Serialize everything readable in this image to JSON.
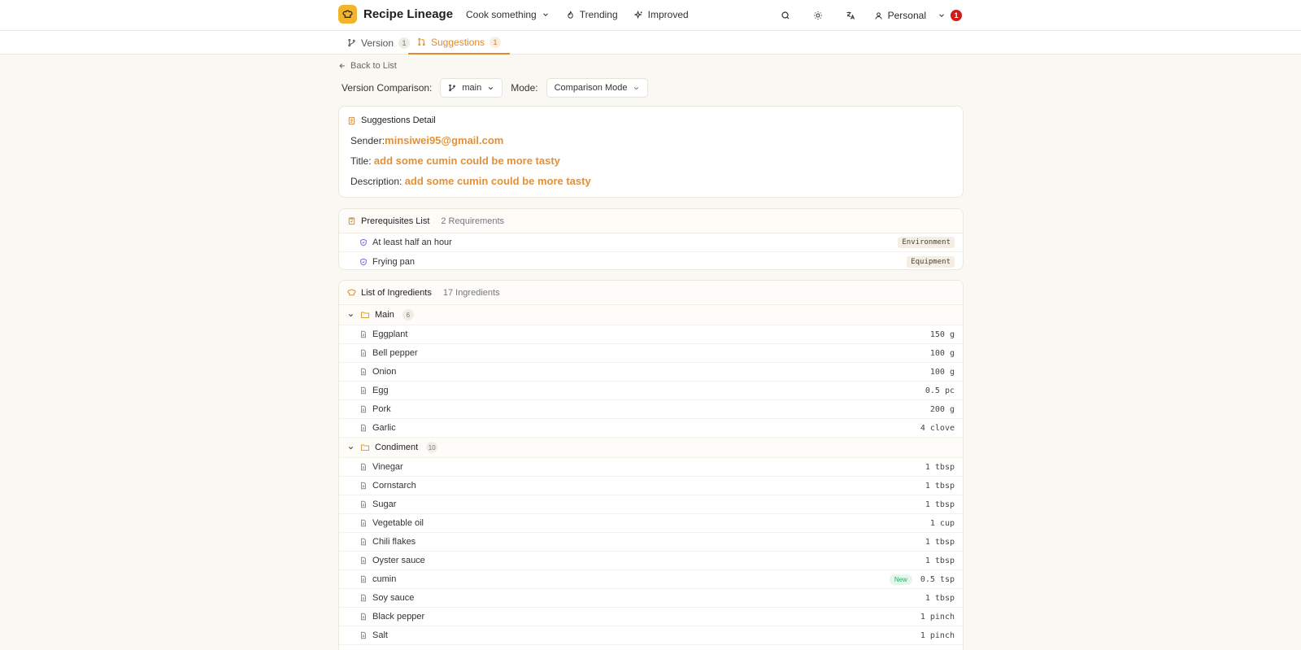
{
  "app": {
    "name": "Recipe Lineage"
  },
  "nav": {
    "cook": "Cook something",
    "trending": "Trending",
    "improved": "Improved"
  },
  "profile": {
    "label": "Personal",
    "notifications": "1"
  },
  "tabs": [
    {
      "label": "Version",
      "count": "1"
    },
    {
      "label": "Suggestions",
      "count": "1"
    }
  ],
  "back": {
    "label": "Back to List"
  },
  "comparison": {
    "version_label": "Version Comparison:",
    "version_value": "main",
    "mode_label": "Mode:",
    "mode_value": "Comparison Mode"
  },
  "suggestion": {
    "heading": "Suggestions Detail",
    "sender_label": "Sender:",
    "sender": "minsiwei95@gmail.com",
    "title_label": "Title:",
    "title": "add some cumin could be more tasty",
    "description_label": "Description:",
    "description": "add some cumin could be more tasty"
  },
  "prerequisites": {
    "heading": "Prerequisites List",
    "count": "2 Requirements",
    "items": [
      {
        "label": "At least half an hour",
        "tag": "Environment"
      },
      {
        "label": "Frying pan",
        "tag": "Equipment"
      }
    ]
  },
  "ingredients": {
    "heading": "List of Ingredients",
    "count": "17 Ingredients",
    "groups": [
      {
        "name": "Main",
        "count": "6",
        "items": [
          {
            "name": "Eggplant",
            "qty": "150 g"
          },
          {
            "name": "Bell pepper",
            "qty": "100 g"
          },
          {
            "name": "Onion",
            "qty": "100 g"
          },
          {
            "name": "Egg",
            "qty": "0.5 pc"
          },
          {
            "name": "Pork",
            "qty": "200 g"
          },
          {
            "name": "Garlic",
            "qty": "4 clove"
          }
        ]
      },
      {
        "name": "Condiment",
        "count": "10",
        "items": [
          {
            "name": "Vinegar",
            "qty": "1 tbsp"
          },
          {
            "name": "Cornstarch",
            "qty": "1 tbsp"
          },
          {
            "name": "Sugar",
            "qty": "1 tbsp"
          },
          {
            "name": "Vegetable oil",
            "qty": "1 cup"
          },
          {
            "name": "Chili flakes",
            "qty": "1 tbsp"
          },
          {
            "name": "Oyster sauce",
            "qty": "1 tbsp"
          },
          {
            "name": "cumin",
            "qty": "0.5 tsp",
            "badge": "New"
          },
          {
            "name": "Soy sauce",
            "qty": "1 tbsp"
          },
          {
            "name": "Black pepper",
            "qty": "1 pinch"
          },
          {
            "name": "Salt",
            "qty": "1 pinch"
          }
        ]
      }
    ]
  },
  "colors": {
    "accent": "#e08a2c",
    "brand": "#f1b42b",
    "background": "#faf8f3"
  }
}
